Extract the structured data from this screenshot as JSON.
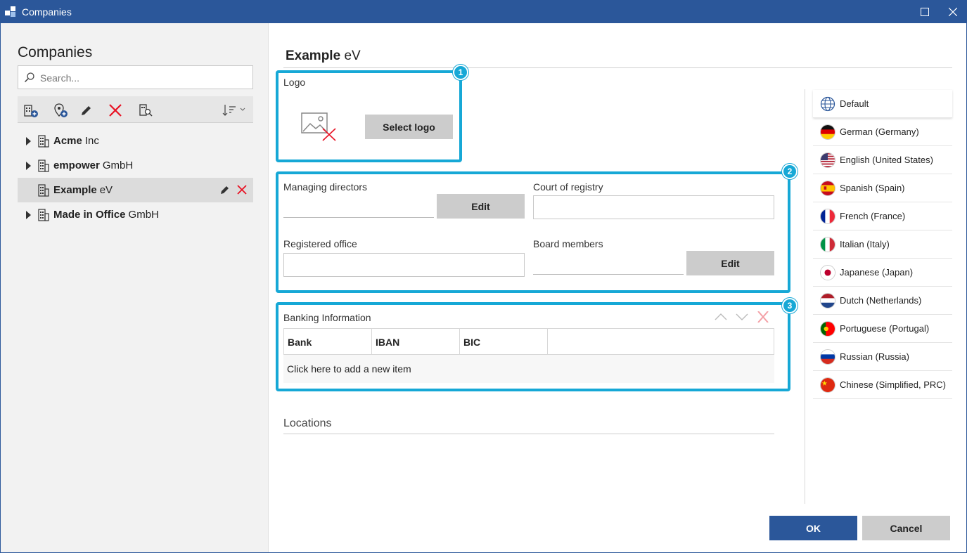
{
  "window": {
    "title": "Companies"
  },
  "sidebar": {
    "heading": "Companies",
    "search_placeholder": "Search...",
    "companies": [
      {
        "name": "Acme",
        "suffix": "Inc",
        "expandable": true,
        "selected": false
      },
      {
        "name": "empower",
        "suffix": "GmbH",
        "expandable": true,
        "selected": false
      },
      {
        "name": "Example",
        "suffix": "eV",
        "expandable": false,
        "selected": true
      },
      {
        "name": "Made in Office",
        "suffix": "GmbH",
        "expandable": true,
        "selected": false
      }
    ]
  },
  "detail": {
    "company_name": "Example",
    "company_suffix": "eV",
    "callouts": [
      "1",
      "2",
      "3"
    ],
    "logo": {
      "label": "Logo",
      "select_button": "Select logo"
    },
    "managing_directors": {
      "label": "Managing directors",
      "edit_button": "Edit"
    },
    "court_of_registry": {
      "label": "Court of registry",
      "value": ""
    },
    "registered_office": {
      "label": "Registered office",
      "value": ""
    },
    "board_members": {
      "label": "Board members",
      "edit_button": "Edit"
    },
    "banking": {
      "label": "Banking Information",
      "columns": [
        "Bank",
        "IBAN",
        "BIC"
      ],
      "add_item_text": "Click here to add a new item"
    },
    "locations_label": "Locations"
  },
  "languages": [
    {
      "label": "Default",
      "icon": "globe-icon",
      "active": true
    },
    {
      "label": "German (Germany)",
      "icon": "flag-de-icon"
    },
    {
      "label": "English (United States)",
      "icon": "flag-us-icon"
    },
    {
      "label": "Spanish (Spain)",
      "icon": "flag-es-icon"
    },
    {
      "label": "French (France)",
      "icon": "flag-fr-icon"
    },
    {
      "label": "Italian (Italy)",
      "icon": "flag-it-icon"
    },
    {
      "label": "Japanese (Japan)",
      "icon": "flag-jp-icon"
    },
    {
      "label": "Dutch (Netherlands)",
      "icon": "flag-nl-icon"
    },
    {
      "label": "Portuguese (Portugal)",
      "icon": "flag-pt-icon"
    },
    {
      "label": "Russian (Russia)",
      "icon": "flag-ru-icon"
    },
    {
      "label": "Chinese (Simplified, PRC)",
      "icon": "flag-cn-icon"
    }
  ],
  "footer": {
    "ok": "OK",
    "cancel": "Cancel"
  },
  "colors": {
    "accent": "#2b579a",
    "highlight": "#16a8d6",
    "delete": "#e81123"
  }
}
